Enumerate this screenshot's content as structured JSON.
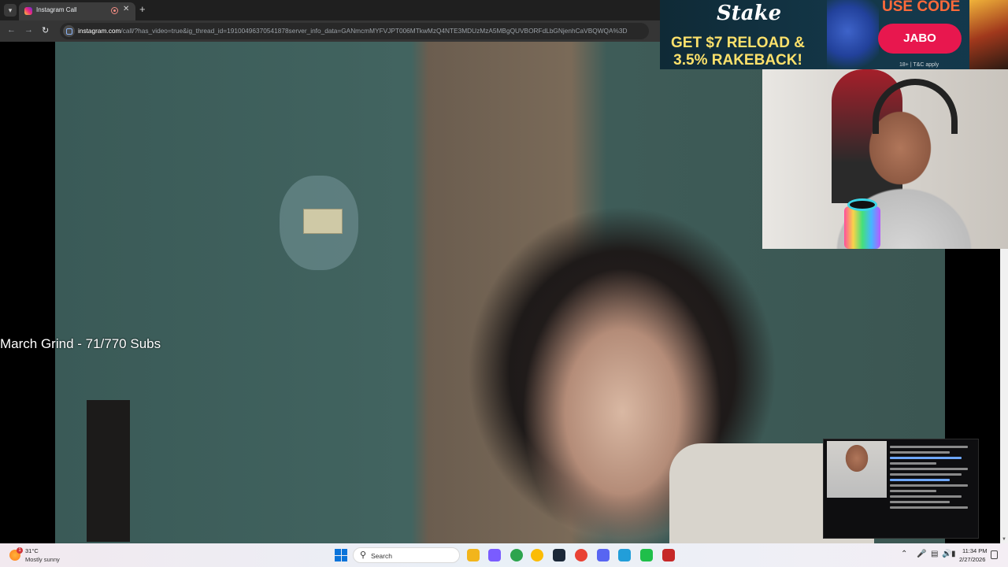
{
  "browser": {
    "tab_title": "Instagram Call",
    "new_tab_symbol": "+",
    "close_symbol": "✕",
    "url_host": "instagram.com",
    "url_path": "/call/?has_video=true&ig_thread_id=19100496370541878server_info_data=GANmcmMYFVJPT006MTkwMzQ4NTE3MDUzMzA5MBgQUVBORFdLbGNjenhCaVBQWQA%3D"
  },
  "stream_overlay": {
    "goal_text": "March Grind - 71/770 Subs"
  },
  "ad": {
    "brand": "Stake",
    "headline_line1": "GET $7 RELOAD &",
    "headline_line2": "3.5% RAKEBACK!",
    "promo_label": "USE CODE",
    "promo_code": "JABO",
    "terms": "18+ | T&C apply"
  },
  "taskbar": {
    "weather_temp": "31°C",
    "weather_desc": "Mostly sunny",
    "weather_badge": "1",
    "search_placeholder": "Search",
    "clock_time": "11:34 PM",
    "clock_date": "2/27/2026",
    "pinned_apps": [
      "file-explorer-icon",
      "copilot-icon",
      "chrome-icon",
      "chrome-icon",
      "steam-icon",
      "chrome-icon",
      "discord-icon",
      "telegram-icon",
      "app-icon",
      "app-icon"
    ],
    "app_colors": [
      "#f2b51c",
      "#7a5cff",
      "#2da44e",
      "#fbbc05",
      "#1b2838",
      "#e94235",
      "#5865f2",
      "#229ed9",
      "#1fbf4a",
      "#c62828"
    ]
  }
}
